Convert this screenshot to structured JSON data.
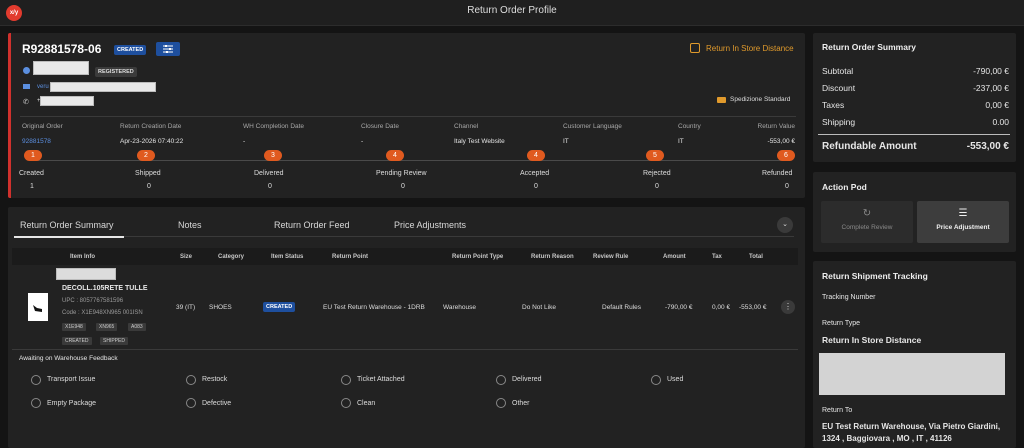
{
  "window": {
    "title": "Return Order Profile",
    "logo": "x/y"
  },
  "order": {
    "id": "R92881578-06",
    "status_badge": "CREATED",
    "customer_badge": "REGISTERED",
    "email_prefix": "veru",
    "phone_prefix": "+",
    "return_type_link": "Return In Store Distance",
    "shipping_method": "Spedizione Standard"
  },
  "details": {
    "original_order": {
      "label": "Original Order",
      "value": "92881578"
    },
    "creation_date": {
      "label": "Return Creation Date",
      "value": "Apr-23-2026 07:40:22"
    },
    "wh_completion": {
      "label": "WH Completion Date",
      "value": "-"
    },
    "closure": {
      "label": "Closure Date",
      "value": "-"
    },
    "channel": {
      "label": "Channel",
      "value": "Italy Test Website"
    },
    "language": {
      "label": "Customer Language",
      "value": "IT"
    },
    "country": {
      "label": "Country",
      "value": "IT"
    },
    "return_value": {
      "label": "Return Value",
      "value": "-553,00 €"
    }
  },
  "steps": [
    {
      "num": "1",
      "name": "Created",
      "count": "1"
    },
    {
      "num": "2",
      "name": "Shipped",
      "count": "0"
    },
    {
      "num": "3",
      "name": "Delivered",
      "count": "0"
    },
    {
      "num": "4",
      "name": "Pending Review",
      "count": "0"
    },
    {
      "num": "4",
      "name": "Accepted",
      "count": "0"
    },
    {
      "num": "5",
      "name": "Rejected",
      "count": "0"
    },
    {
      "num": "6",
      "name": "Refunded",
      "count": "0"
    }
  ],
  "tabs": [
    "Return Order Summary",
    "Notes",
    "Return Order Feed",
    "Price Adjustments"
  ],
  "table": {
    "headers": [
      "Item Info",
      "Size",
      "Category",
      "Item Status",
      "Return Point",
      "Return Point Type",
      "Return Reason",
      "Review Rule",
      "Amount",
      "Tax",
      "Total"
    ],
    "item": {
      "name": "DECOLL.105RETE TULLE",
      "upc": "UPC : 8057767581596",
      "code": "Code : X1E948XN965 001ISN",
      "tags": [
        "X1E948",
        "XN965",
        "A083"
      ],
      "states": [
        "CREATED",
        "SHIPPED"
      ],
      "size": "39 (IT)",
      "category": "SHOES",
      "status": "CREATED",
      "return_point": "EU Test Return Warehouse - 1DRB",
      "return_point_type": "Warehouse",
      "reason": "Do Not Like",
      "rule": "Default Rules",
      "amount": "-790,00 €",
      "tax": "0,00 €",
      "total": "-553,00 €"
    }
  },
  "feedback": {
    "title": "Awaiting on Warehouse Feedback",
    "options_row1": [
      "Transport Issue",
      "Restock",
      "Ticket Attached",
      "Delivered",
      "Used"
    ],
    "options_row2": [
      "Empty Package",
      "Defective",
      "Clean",
      "Other"
    ]
  },
  "summary": {
    "title": "Return Order Summary",
    "subtotal": {
      "label": "Subtotal",
      "value": "-790,00 €"
    },
    "discount": {
      "label": "Discount",
      "value": "-237,00 €"
    },
    "taxes": {
      "label": "Taxes",
      "value": "0,00 €"
    },
    "shipping": {
      "label": "Shipping",
      "value": "0.00"
    },
    "refundable": {
      "label": "Refundable Amount",
      "value": "-553,00 €"
    }
  },
  "action_pod": {
    "title": "Action Pod",
    "complete_review": "Complete Review",
    "price_adjustment": "Price Adjustment"
  },
  "tracking": {
    "title": "Return Shipment Tracking",
    "tracking_number_label": "Tracking Number",
    "return_type_label": "Return Type",
    "return_type_value": "Return In Store Distance",
    "return_to_label": "Return To",
    "return_to_value": "EU Test Return Warehouse, Via Pietro Giardini, 1324 , Baggiovara , MO , IT , 41126"
  },
  "colors": {
    "accent_orange": "#e05a1f",
    "badge_blue": "#1e4f9e",
    "left_border_red": "#d0312d"
  }
}
